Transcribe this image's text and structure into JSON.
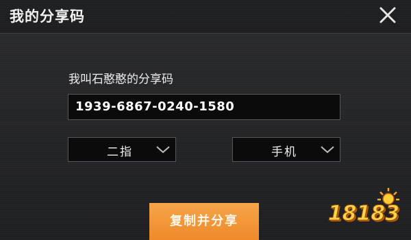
{
  "dialog": {
    "title": "我的分享码",
    "close_icon": "close-icon"
  },
  "form": {
    "label": "我叫石憨憨的分享码",
    "code": "1939-6867-0240-1580",
    "control_select": {
      "value": "二指",
      "icon": "chevron-down-icon"
    },
    "device_select": {
      "value": "手机",
      "icon": "chevron-down-icon"
    }
  },
  "actions": {
    "share_label": "复制并分享"
  },
  "watermark": {
    "text": "18183"
  },
  "colors": {
    "background": "#202124",
    "field_background": "#0b0b0c",
    "button_orange": "#ee8a2a",
    "text": "#ffffff"
  }
}
